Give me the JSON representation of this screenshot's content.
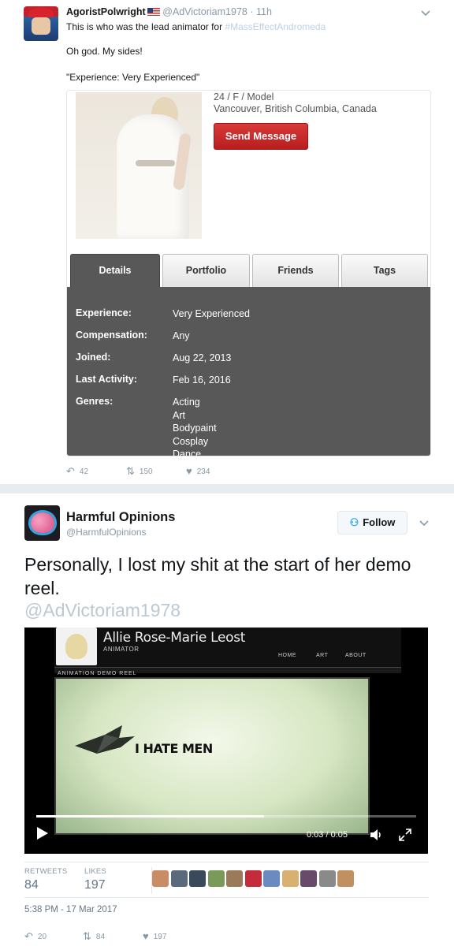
{
  "tweet1": {
    "author_name": "AgoristPolwright",
    "handle": "@AdVictoriam1978",
    "time": "11h",
    "text_main": "This is who was the lead animator for ",
    "hashtag": "#MassEffectAndromeda",
    "line2": "Oh god. My sides!",
    "line3": "\"Experience: Very Experienced\"",
    "card": {
      "profile_line1": "24 / F / Model",
      "profile_line2": "Vancouver, British Columbia, Canada",
      "send_message": "Send Message",
      "tabs": [
        "Details",
        "Portfolio",
        "Friends",
        "Tags"
      ],
      "details": [
        {
          "key": "Experience:",
          "value": "Very Experienced"
        },
        {
          "key": "Compensation:",
          "value": "Any"
        },
        {
          "key": "Joined:",
          "value": "Aug 22, 2013"
        },
        {
          "key": "Last Activity:",
          "value": "Feb 16, 2016"
        },
        {
          "key": "Genres:",
          "value": [
            "Acting",
            "Art",
            "Bodypaint",
            "Cosplay",
            "Dance"
          ]
        }
      ]
    },
    "actions": {
      "replies": "42",
      "retweets": "150",
      "likes": "234"
    }
  },
  "tweet2": {
    "author_name": "Harmful Opinions",
    "handle": "@HarmfulOpinions",
    "follow_label": "Follow",
    "text": "Personally, I lost my shit at the start of her demo reel.",
    "mention": "@AdVictoriam1978",
    "video": {
      "site_title": "Allie Rose-Marie Leost",
      "site_subtitle": "ANIMATOR",
      "nav": [
        "HOME",
        "ART",
        "ABOUT"
      ],
      "reel_label": "ANIMATION DEMO REEL",
      "caption": "I HATE MEN",
      "time": "0:03 / 0:05",
      "progress": 0.6
    },
    "stats": {
      "retweets_label": "RETWEETS",
      "retweets": "84",
      "likes_label": "LIKES",
      "likes": "197"
    },
    "liker_colors": [
      "#c98c64",
      "#5a6a7a",
      "#3b4a5a",
      "#7a9a5a",
      "#9a7a5a",
      "#c42b3b",
      "#6a8ac0",
      "#d8b070",
      "#6a4a6a",
      "#8a8a8a",
      "#c09060"
    ],
    "timestamp": "5:38 PM - 17 Mar 2017",
    "actions": {
      "replies": "20",
      "retweets": "84",
      "likes": "197"
    }
  }
}
